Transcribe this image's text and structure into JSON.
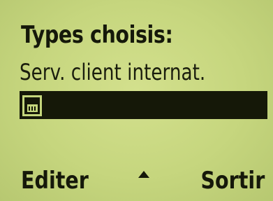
{
  "screen": {
    "title": "Types choisis:",
    "list": {
      "item_1": "Serv. client internat.",
      "item_2_icon": "sim-card-icon"
    }
  },
  "softkeys": {
    "left": "Editer",
    "middle_icon": "up-arrow-icon",
    "right": "Sortir"
  },
  "colors": {
    "lcd_background": "#c4d67c",
    "foreground": "#15180a"
  }
}
